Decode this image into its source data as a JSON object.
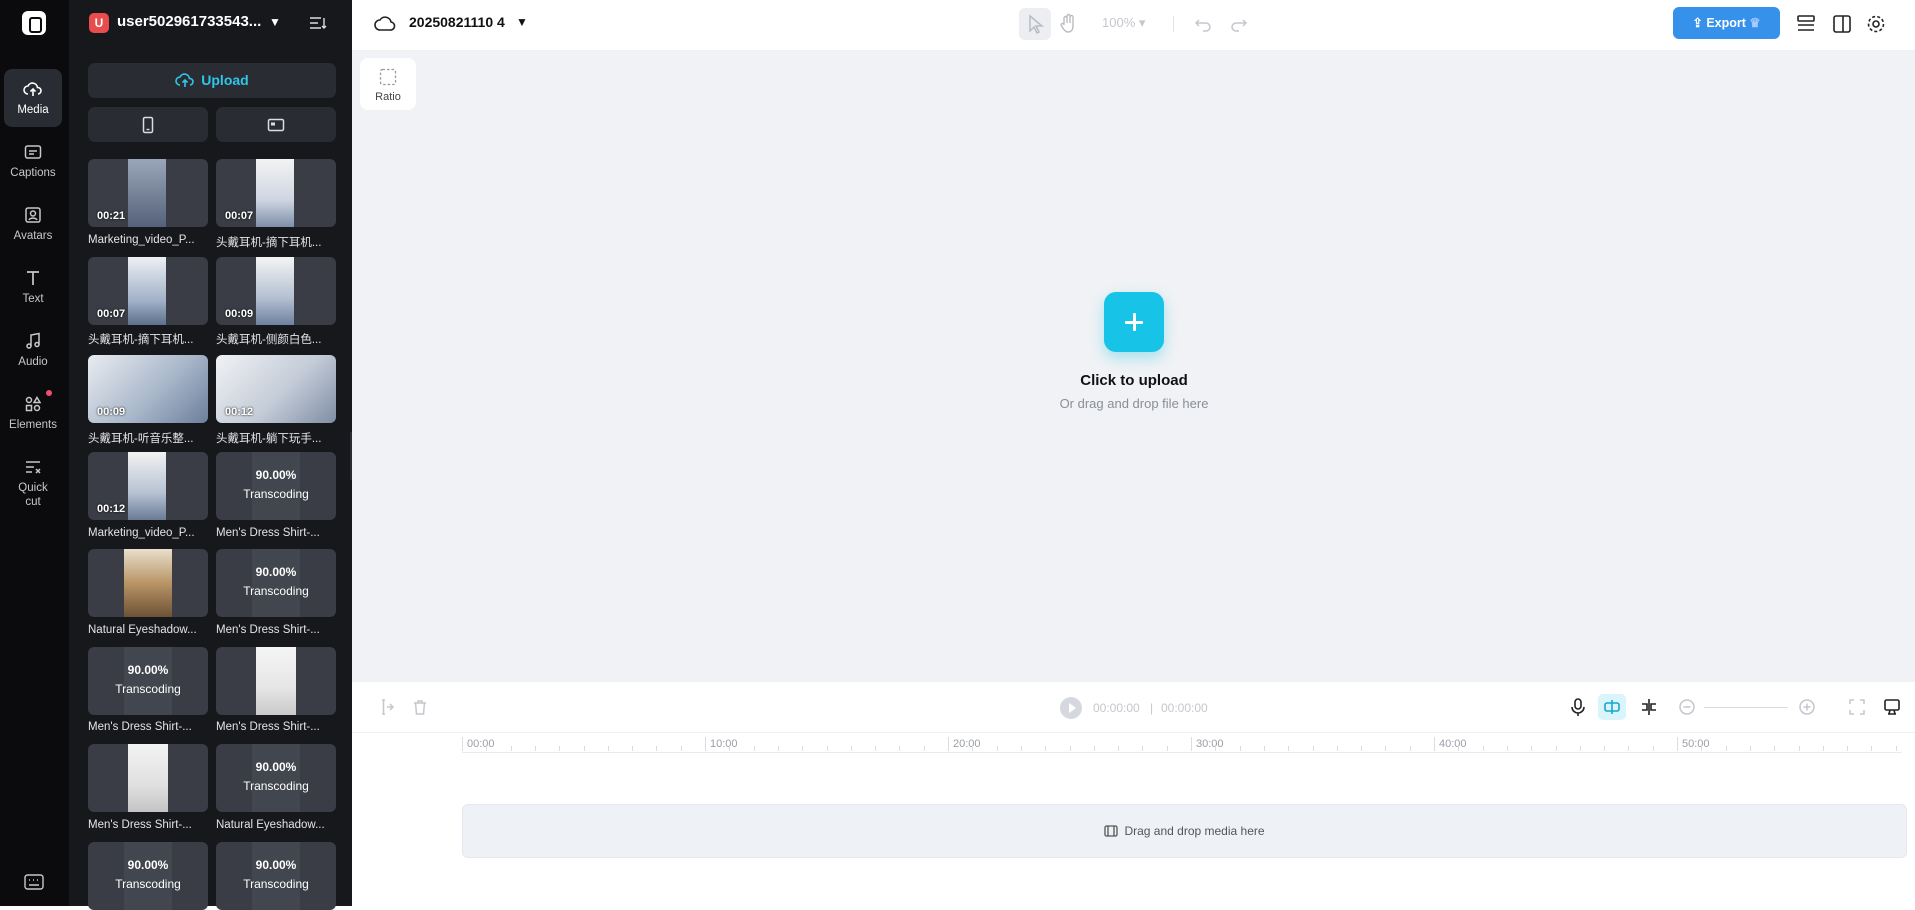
{
  "nav": {
    "items": [
      {
        "label": "Media",
        "icon": "cloud-upload-icon"
      },
      {
        "label": "Captions",
        "icon": "captions-icon"
      },
      {
        "label": "Avatars",
        "icon": "avatar-icon"
      },
      {
        "label": "Text",
        "icon": "text-icon"
      },
      {
        "label": "Audio",
        "icon": "music-note-icon"
      },
      {
        "label": "Elements",
        "icon": "elements-icon"
      },
      {
        "label": "Quick",
        "label2": "cut",
        "icon": "quick-cut-icon"
      }
    ]
  },
  "panel": {
    "avatar_letter": "U",
    "username": "user502961733543...",
    "upload_label": "Upload",
    "media": [
      {
        "name": "Marketing_video_P...",
        "duration": "00:21"
      },
      {
        "name": "头戴耳机-摘下耳机...",
        "duration": "00:07"
      },
      {
        "name": "头戴耳机-摘下耳机...",
        "duration": "00:07"
      },
      {
        "name": "头戴耳机-侧颜白色...",
        "duration": "00:09"
      },
      {
        "name": "头戴耳机-听音乐整...",
        "duration": "00:09"
      },
      {
        "name": "头戴耳机-躺下玩手...",
        "duration": "00:12"
      },
      {
        "name": "Marketing_video_P...",
        "duration": "00:12"
      },
      {
        "name": "Men's Dress Shirt-...",
        "progress": "90.00%",
        "status": "Transcoding"
      },
      {
        "name": "Natural Eyeshadow...",
        "duration": ""
      },
      {
        "name": "Men's Dress Shirt-...",
        "progress": "90.00%",
        "status": "Transcoding"
      },
      {
        "name": "Men's Dress Shirt-...",
        "progress": "90.00%",
        "status": "Transcoding"
      },
      {
        "name": "Men's Dress Shirt-...",
        "duration": ""
      },
      {
        "name": "Men's Dress Shirt-...",
        "duration": ""
      },
      {
        "name": "Natural Eyeshadow...",
        "progress": "90.00%",
        "status": "Transcoding"
      },
      {
        "name": "",
        "progress": "90.00%",
        "status": "Transcoding"
      },
      {
        "name": "",
        "progress": "90.00%",
        "status": "Transcoding"
      }
    ]
  },
  "header": {
    "project_name": "20250821110 4",
    "zoom": "100%",
    "export_label": "Export"
  },
  "canvas": {
    "ratio_label": "Ratio",
    "upload_title": "Click to upload",
    "upload_subtitle": "Or drag and drop file here"
  },
  "timeline": {
    "current_time": "00:00:00",
    "total_time": "00:00:00",
    "ruler_labels": [
      "00:00",
      "10:00",
      "20:00",
      "30:00",
      "40:00",
      "50:00"
    ],
    "drop_label": "Drag and drop media here"
  },
  "colors": {
    "accent": "#17c3e6",
    "export": "#3591ea",
    "nav_bg": "#0b0b0d",
    "panel_bg": "#17181c",
    "canvas_bg": "#f0f2f5"
  }
}
